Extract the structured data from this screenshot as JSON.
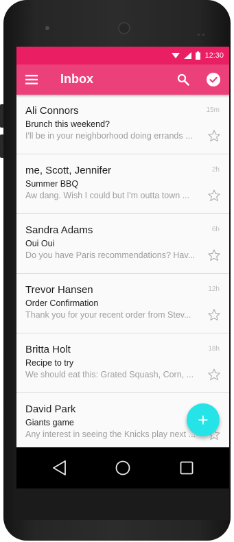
{
  "status_bar": {
    "time": "12:30",
    "icons": [
      "wifi-icon",
      "cell-signal-icon",
      "battery-icon"
    ]
  },
  "app_bar": {
    "title": "Inbox",
    "icons": [
      "menu-icon",
      "search-icon",
      "check-circle-icon"
    ]
  },
  "messages": [
    {
      "sender": "Ali Connors",
      "subject": "Brunch this weekend?",
      "preview": "I'll be in your neighborhood doing errands ...",
      "time": "15m"
    },
    {
      "sender": "me, Scott, Jennifer",
      "subject": "Summer BBQ",
      "preview": "Aw dang. Wish I could but I'm outta town ...",
      "time": "2h"
    },
    {
      "sender": "Sandra Adams",
      "subject": "Oui Oui",
      "preview": "Do you have Paris recommendations? Hav...",
      "time": "6h"
    },
    {
      "sender": "Trevor Hansen",
      "subject": "Order Confirmation",
      "preview": "Thank you for your recent order from Stev...",
      "time": "12h"
    },
    {
      "sender": "Britta Holt",
      "subject": "Recipe to try",
      "preview": "We should eat this: Grated Squash, Corn, ...",
      "time": "18h"
    },
    {
      "sender": "David Park",
      "subject": "Giants game",
      "preview": "Any interest in seeing the Knicks play next ...",
      "time": ""
    }
  ],
  "fab": {
    "label": "+",
    "icon": "plus-icon"
  },
  "nav_bar": {
    "icons": [
      "back-icon",
      "home-icon",
      "recents-icon"
    ]
  },
  "colors": {
    "status_bar": "#e91e63",
    "app_bar": "#ec407a",
    "fab": "#26e3e8",
    "list_background": "#fafafa"
  }
}
